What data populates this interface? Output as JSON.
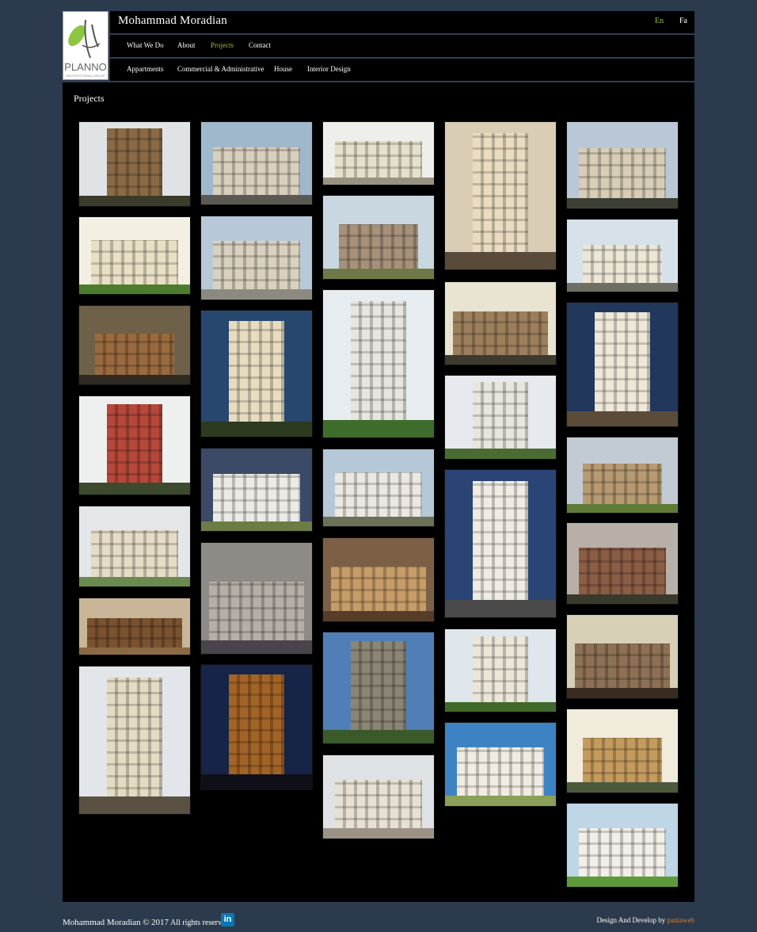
{
  "header": {
    "site_title": "Mohammad Moradian",
    "logo_text": "PLANNO",
    "logo_subtext": "ARCHITECTURAL GROUP",
    "languages": [
      {
        "label": "En",
        "active": true
      },
      {
        "label": "Fa",
        "active": false
      }
    ]
  },
  "nav": {
    "items": [
      {
        "label": "What We Do",
        "active": false
      },
      {
        "label": "About",
        "active": false
      },
      {
        "label": "Projects",
        "active": true
      },
      {
        "label": "Contact",
        "active": false
      }
    ]
  },
  "subnav": {
    "items": [
      {
        "label": "Appartments"
      },
      {
        "label": "Commercial & Administrative"
      },
      {
        "label": "House"
      },
      {
        "label": "Interior Design"
      }
    ]
  },
  "main": {
    "title": "Projects"
  },
  "gallery": {
    "columns": [
      {
        "items": [
          {
            "sky": "#dfe3e6",
            "bldg": "#8a6a45",
            "ground": "#3b3b2a",
            "kind": "tower"
          },
          {
            "sky": "#f3efe2",
            "bldg": "#e9dfc4",
            "ground": "#4c7d2c",
            "kind": "villa"
          },
          {
            "sky": "#6f6049",
            "bldg": "#9a6a3f",
            "ground": "#2f2b22",
            "kind": "house"
          },
          {
            "sky": "#eef0f0",
            "bldg": "#b5483a",
            "ground": "#3d4a2d",
            "kind": "tower"
          },
          {
            "sky": "#e4e7ea",
            "bldg": "#e6dcc6",
            "ground": "#6a8a50",
            "kind": "villa"
          },
          {
            "sky": "#c9b597",
            "bldg": "#7a5230",
            "ground": "#8a6a45",
            "kind": "interior"
          },
          {
            "sky": "#e2e6ea",
            "bldg": "#e3dcc3",
            "ground": "#5b5142",
            "kind": "tower"
          }
        ]
      },
      {
        "items": [
          {
            "sky": "#9fb8cc",
            "bldg": "#d8d0bd",
            "ground": "#5b5a52",
            "kind": "villa"
          },
          {
            "sky": "#b7c9d8",
            "bldg": "#d9d1bf",
            "ground": "#8c8a80",
            "kind": "villa"
          },
          {
            "sky": "#27476f",
            "bldg": "#e8dcc0",
            "ground": "#2c3a1f",
            "kind": "tower"
          },
          {
            "sky": "#3b4a66",
            "bldg": "#eceae4",
            "ground": "#6c7c45",
            "kind": "villa"
          },
          {
            "sky": "#8e8a86",
            "bldg": "#b7aea8",
            "ground": "#4c444c",
            "kind": "interior"
          },
          {
            "sky": "#152447",
            "bldg": "#a26327",
            "ground": "#0f0f18",
            "kind": "tower"
          }
        ]
      },
      {
        "items": [
          {
            "sky": "#eeeeea",
            "bldg": "#e6dfca",
            "ground": "#9a9280",
            "kind": "villa"
          },
          {
            "sky": "#c9d7e0",
            "bldg": "#a7917a",
            "ground": "#6d7a46",
            "kind": "house"
          },
          {
            "sky": "#e6ecef",
            "bldg": "#e7e5df",
            "ground": "#3e6d2b",
            "kind": "tower"
          },
          {
            "sky": "#b5c8d8",
            "bldg": "#ebe8e1",
            "ground": "#6a7156",
            "kind": "villa"
          },
          {
            "sky": "#7b6046",
            "bldg": "#c69c68",
            "ground": "#553d2a",
            "kind": "interior"
          },
          {
            "sky": "#4f7fb6",
            "bldg": "#8c8576",
            "ground": "#3b5a2a",
            "kind": "tower"
          },
          {
            "sky": "#dfe2e4",
            "bldg": "#e7e1d3",
            "ground": "#9c9387",
            "kind": "villa"
          }
        ]
      },
      {
        "items": [
          {
            "sky": "#d9cdb5",
            "bldg": "#e9dcc0",
            "ground": "#5a4a3a",
            "kind": "tower"
          },
          {
            "sky": "#e9e3d2",
            "bldg": "#9d7f5c",
            "ground": "#3e3a30",
            "kind": "interior"
          },
          {
            "sky": "#e6eaee",
            "bldg": "#e8e5dc",
            "ground": "#4a6c33",
            "kind": "tower"
          },
          {
            "sky": "#2a4476",
            "bldg": "#f0ece4",
            "ground": "#4a4a4a",
            "kind": "tower"
          },
          {
            "sky": "#dfe6ec",
            "bldg": "#ebe6d8",
            "ground": "#3f6a2b",
            "kind": "tower"
          },
          {
            "sky": "#3d83c4",
            "bldg": "#f1ece2",
            "ground": "#8aa05a",
            "kind": "villa"
          }
        ]
      },
      {
        "items": [
          {
            "sky": "#b9c7d6",
            "bldg": "#d8cdb6",
            "ground": "#3c3f33",
            "kind": "villa"
          },
          {
            "sky": "#d6e1ea",
            "bldg": "#ece6d6",
            "ground": "#6f6e62",
            "kind": "house"
          },
          {
            "sky": "#21375c",
            "bldg": "#efe8d8",
            "ground": "#5b4c3a",
            "kind": "tower"
          },
          {
            "sky": "#c2cbd3",
            "bldg": "#b79a72",
            "ground": "#5e7c35",
            "kind": "house"
          },
          {
            "sky": "#b8b0a8",
            "bldg": "#8c5d45",
            "ground": "#3a3a2c",
            "kind": "villa"
          },
          {
            "sky": "#d8cfb7",
            "bldg": "#8e7155",
            "ground": "#3a2b20",
            "kind": "interior"
          },
          {
            "sky": "#f1ebdc",
            "bldg": "#c49b5c",
            "ground": "#4b5a3b",
            "kind": "house"
          },
          {
            "sky": "#bed6e6",
            "bldg": "#f1efe8",
            "ground": "#5e9a3a",
            "kind": "villa"
          }
        ]
      }
    ]
  },
  "footer": {
    "copyright_name": "Mohammad Moradian",
    "copyright_symbol": "©",
    "year": "2017",
    "rights": "All rights reserved",
    "linkedin_label": "in",
    "credit_prefix": "Design And Develop by",
    "credit_link": "paniaweb"
  }
}
